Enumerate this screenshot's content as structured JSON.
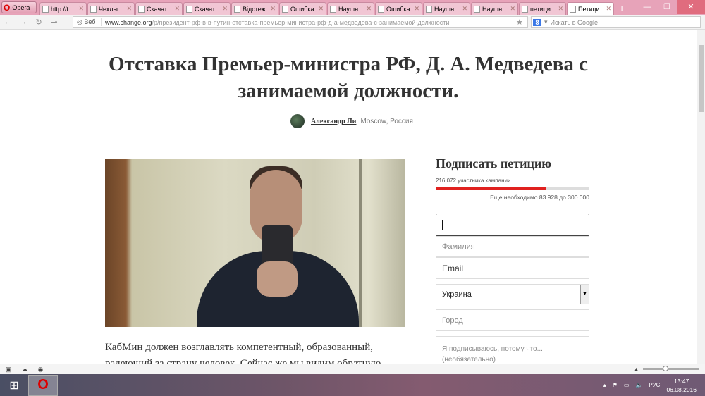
{
  "browser": {
    "menu_label": "Opera",
    "tabs": [
      {
        "title": "http://t...",
        "active": false
      },
      {
        "title": "Чехлы ...",
        "active": false
      },
      {
        "title": "Скачат...",
        "active": false
      },
      {
        "title": "Скачат...",
        "active": false
      },
      {
        "title": "Відстеж...",
        "active": false
      },
      {
        "title": "Ошибка",
        "active": false
      },
      {
        "title": "Наушн...",
        "active": false
      },
      {
        "title": "Ошибка",
        "active": false
      },
      {
        "title": "Наушн...",
        "active": false
      },
      {
        "title": "Наушн...",
        "active": false
      },
      {
        "title": "петици...",
        "active": false
      },
      {
        "title": "Петици...",
        "active": true
      }
    ],
    "address": {
      "mode_label": "Веб",
      "domain": "www.change.org",
      "path": "/p/президент-рф-в-в-путин-отставка-премьер-министра-рф-д-а-медведева-с-занимаемой-должности"
    },
    "search_placeholder": "Искать в Google"
  },
  "page": {
    "title": "Отставка Премьер-министра РФ, Д. А. Медведева с занимаемой должности.",
    "author": {
      "name": "Александр Ли",
      "location": "Moscow, Россия"
    },
    "body": "КабМин должен возглавлять компетентный, образованный, радеющий за страну человек. Сейчас же мы видим обратную",
    "sign": {
      "heading": "Подписать петицию",
      "supporters": "216 072 участника кампании",
      "progress_percent": 72,
      "needed": "Еще необходимо 83 928 до 300 000",
      "first_name_value": "",
      "last_name_placeholder": "Фамилия",
      "email_placeholder": "Email",
      "country": "Украина",
      "city_placeholder": "Город",
      "reason_placeholder": "Я подписываюсь, потому что... (необязательно)"
    }
  },
  "taskbar": {
    "language": "РУС",
    "time": "13:47",
    "date": "06.08.2016"
  }
}
